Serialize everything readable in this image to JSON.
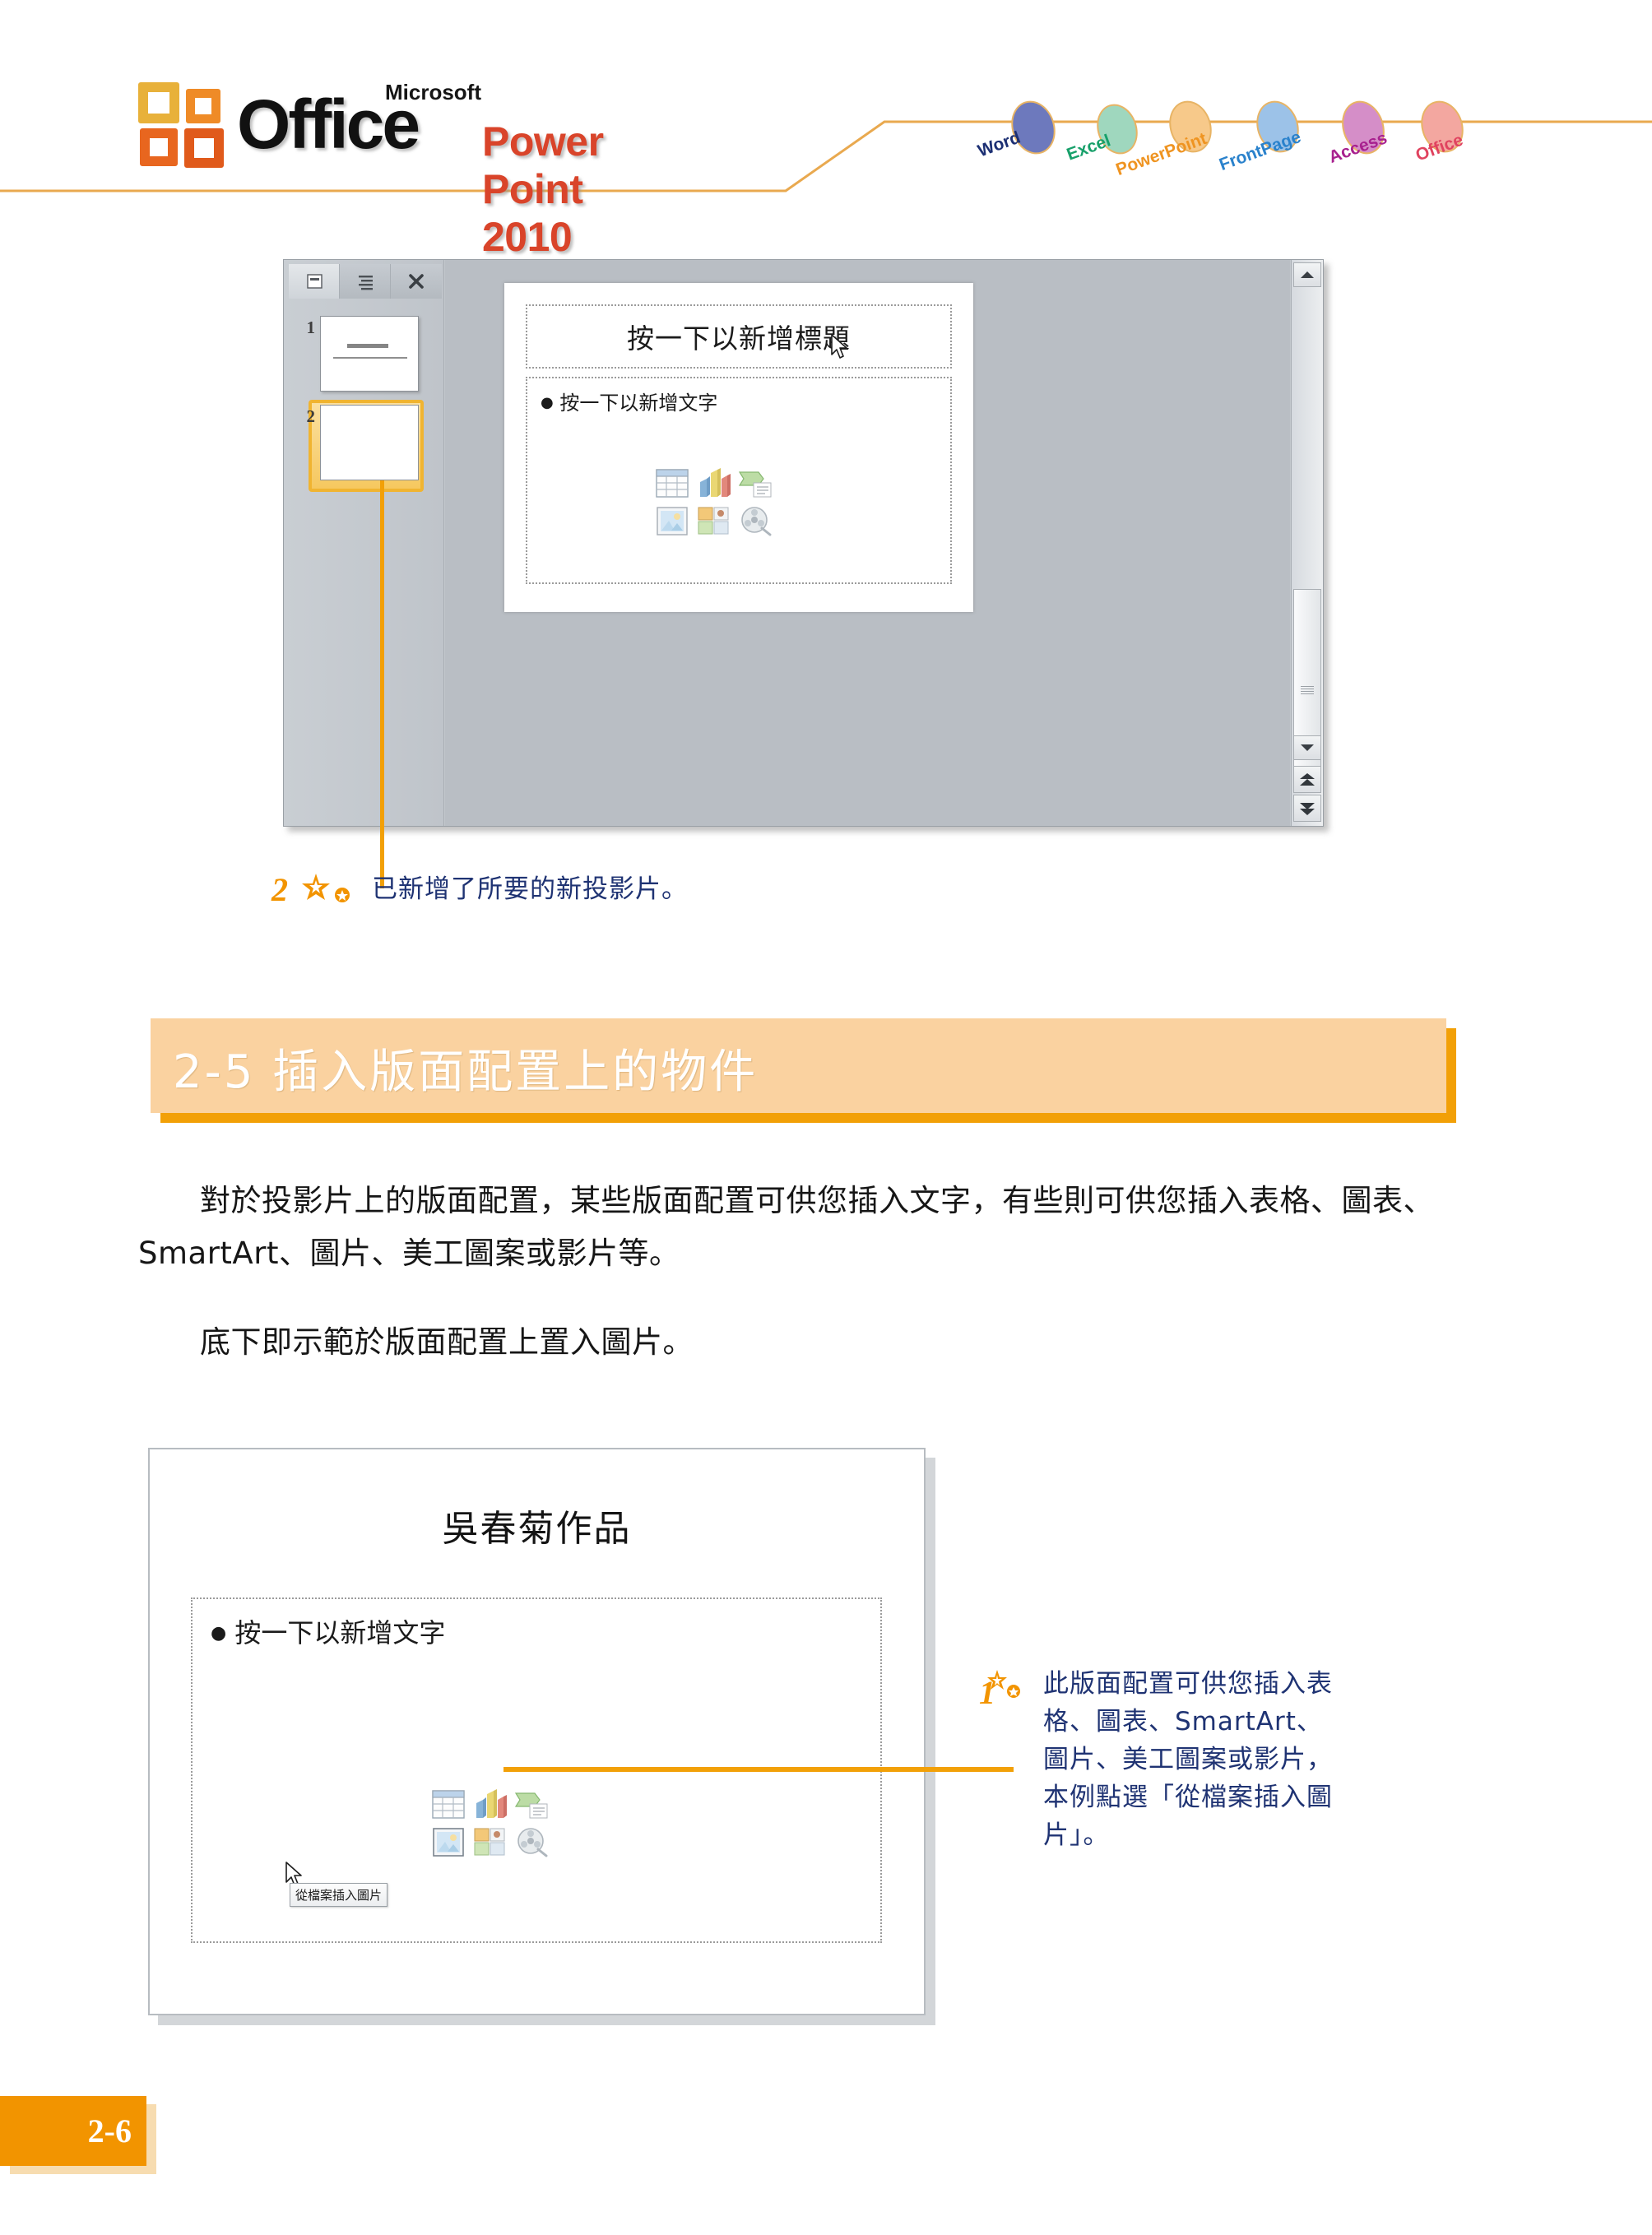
{
  "header": {
    "brand_microsoft": "Microsoft",
    "brand_office": "Office",
    "product": "Power Point 2010",
    "tabs": [
      {
        "label": "Word",
        "chip_color": "#6d79bd",
        "text_color": "#1c2f73"
      },
      {
        "label": "Excel",
        "chip_color": "#9fd7be",
        "text_color": "#17a06a"
      },
      {
        "label": "PowerPoint",
        "chip_color": "#f7c98a",
        "text_color": "#ef9421"
      },
      {
        "label": "FrontPage",
        "chip_color": "#9cc2e8",
        "text_color": "#2a82cc"
      },
      {
        "label": "Access",
        "chip_color": "#d58ec8",
        "text_color": "#a8218f"
      },
      {
        "label": "Office",
        "chip_color": "#f3a7a0",
        "text_color": "#e0435f"
      }
    ],
    "rule_color": "#e9a94f"
  },
  "pp_window": {
    "tabs": [
      {
        "name": "slides-tab",
        "icon": "slide-thumbnail-icon",
        "state": "active"
      },
      {
        "name": "outline-tab",
        "icon": "outline-lines-icon",
        "state": "inactive"
      },
      {
        "name": "close-tab",
        "icon": "close-icon",
        "state": "inactive"
      }
    ],
    "thumbnails": [
      {
        "number": "1",
        "selected": false
      },
      {
        "number": "2",
        "selected": true
      }
    ],
    "slide": {
      "title_placeholder": "按一下以新增標題",
      "body_bullet": "按一下以新增文字",
      "content_icons": [
        "insert-table-icon",
        "insert-chart-icon",
        "insert-smartart-icon",
        "insert-picture-from-file-icon",
        "insert-clipart-icon",
        "insert-media-clip-icon"
      ]
    },
    "scrollbar": {
      "up_arrow": "scroll-up-icon",
      "down_arrow": "scroll-down-icon",
      "prev_slide": "previous-slide-icon",
      "next_slide": "next-slide-icon"
    }
  },
  "callout_top": {
    "number": "2",
    "text": "已新增了所要的新投影片。"
  },
  "section": {
    "title": "2-5 插入版面配置上的物件"
  },
  "paragraphs": [
    "　　對於投影片上的版面配置，某些版面配置可供您插入文字，有些則可供您插入表格、圖表、SmartArt、圖片、美工圖案或影片等。",
    "　　底下即示範於版面配置上置入圖片。"
  ],
  "figure_bottom": {
    "title": "吳春菊作品",
    "body_bullet": "按一下以新增文字",
    "tooltip": "從檔案插入圖片",
    "content_icons": [
      "insert-table-icon",
      "insert-chart-icon",
      "insert-smartart-icon",
      "insert-picture-from-file-icon",
      "insert-clipart-icon",
      "insert-media-clip-icon"
    ]
  },
  "callout_bottom": {
    "number": "1",
    "lines": [
      "此版面配置可供您插入表",
      "格、圖表、SmartArt、",
      "圖片、美工圖案或影片，",
      "本例點選「從檔案插入圖",
      "片」。"
    ]
  },
  "footer": {
    "page_number": "2-6"
  },
  "colors": {
    "accent_orange": "#f29400",
    "band_light_orange": "#fad2a0",
    "callout_navy": "#1f3373",
    "window_gray": "#c3c8cd"
  }
}
